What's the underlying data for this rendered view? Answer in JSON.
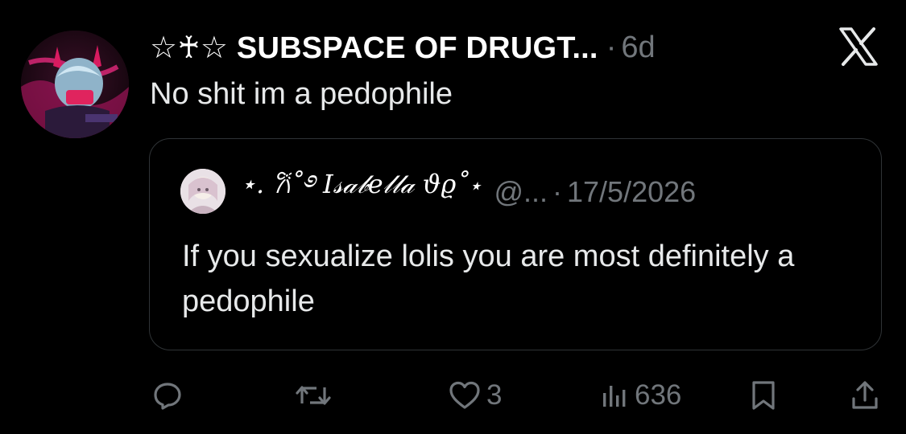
{
  "tweet": {
    "author": {
      "display_name": "☆♰☆ SUBSPACE OF DRUGT...",
      "avatar_icon": "avatar-image"
    },
    "separator": "·",
    "time": "6d",
    "text": "No shit im a pedophile",
    "brand_icon": "x-logo-icon"
  },
  "quote": {
    "author": {
      "display_name": "⋆. 𐙚˚࿔ 𝐼𝓈𝒶𝒷𝑒𝓁𝓁𝒶 𝜗𝜚˚⋆",
      "handle": "@...",
      "avatar_icon": "avatar-image"
    },
    "separator": "·",
    "date": "17/5/2026",
    "text": "If you sexualize lolis you are most definitely a pedophile"
  },
  "actions": {
    "reply": {
      "icon": "reply-icon",
      "count": ""
    },
    "retweet": {
      "icon": "retweet-icon",
      "count": ""
    },
    "like": {
      "icon": "heart-icon",
      "count": "3"
    },
    "views": {
      "icon": "views-icon",
      "count": "636"
    },
    "bookmark": {
      "icon": "bookmark-icon"
    },
    "share": {
      "icon": "share-icon"
    }
  },
  "colors": {
    "background": "#000000",
    "text_primary": "#e7e9ea",
    "text_secondary": "#71767b",
    "border": "#2f3336"
  }
}
